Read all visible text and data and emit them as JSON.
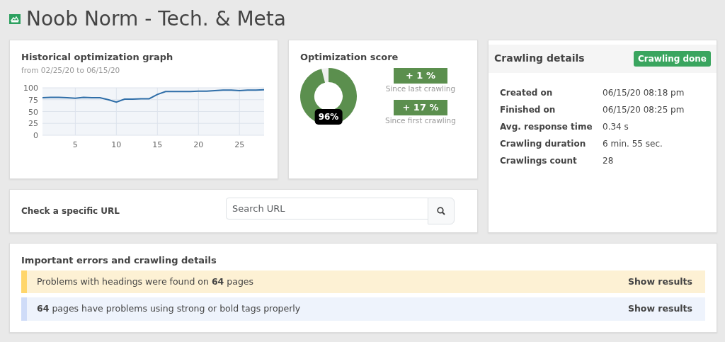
{
  "page_title": "Noob Norm - Tech. & Meta",
  "history": {
    "title": "Historical optimization graph",
    "subtitle": "from 02/25/20 to 06/15/20",
    "chart_data": {
      "type": "line",
      "x": [
        1,
        2,
        3,
        4,
        5,
        6,
        7,
        8,
        9,
        10,
        11,
        12,
        13,
        14,
        15,
        16,
        17,
        18,
        19,
        20,
        21,
        22,
        23,
        24,
        25,
        26,
        27,
        28
      ],
      "series": [
        {
          "color": "#2f6ea8",
          "values": [
            79,
            80,
            80,
            79,
            78,
            80,
            79,
            79,
            75,
            70,
            76,
            76,
            77,
            77,
            86,
            92,
            92,
            92,
            92,
            93,
            93,
            94,
            95,
            95,
            94,
            95,
            95,
            96
          ]
        }
      ],
      "grid": true,
      "xlim": [
        1,
        28
      ],
      "ylim": [
        0,
        100
      ],
      "xticks": [
        5,
        10,
        15,
        20,
        25
      ],
      "yticks": [
        0,
        25,
        50,
        75,
        100
      ]
    }
  },
  "score": {
    "title": "Optimization score",
    "level": 0.96,
    "reading": "96%",
    "changes": [
      {
        "value": "+ 1 %",
        "caption": "Since last crawling"
      },
      {
        "value": "+ 17 %",
        "caption": "Since first crawling"
      }
    ]
  },
  "crawling": {
    "title": "Crawling details",
    "status": "Crawling done",
    "details": [
      {
        "label": "Created on",
        "value": "06/15/20 08:18 pm"
      },
      {
        "label": "Finished on",
        "value": "06/15/20 08:25 pm"
      },
      {
        "label": "Avg. response time",
        "value": "0.34 s"
      },
      {
        "label": "Crawling duration",
        "value": "6 min. 55 sec."
      },
      {
        "label": "Crawlings count",
        "value": "28"
      }
    ]
  },
  "url_check": {
    "label": "Check a specific URL",
    "placeholder": "Search URL"
  },
  "errors": {
    "title": "Important errors and crawling details",
    "items": [
      {
        "kind": "warning",
        "color": "#ffd66b",
        "text": "Problems with headings were found on **64** pages",
        "action": "Show results"
      },
      {
        "kind": "info",
        "color": "#cfdcf8",
        "text": "**64** pages have problems using strong or bold tags properly",
        "action": "Show results"
      }
    ]
  }
}
